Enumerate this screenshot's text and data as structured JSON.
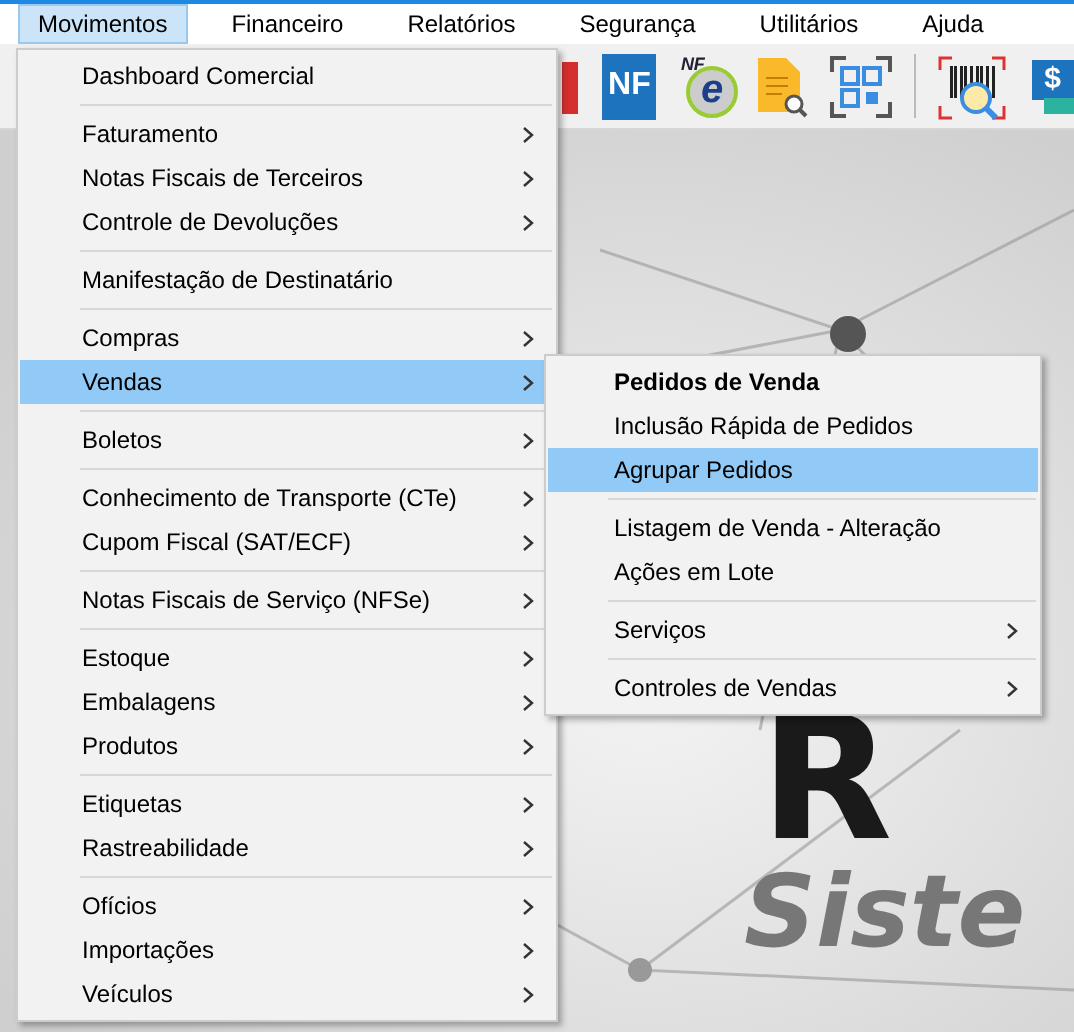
{
  "menubar": [
    {
      "label": "Movimentos",
      "selected": true
    },
    {
      "label": "Financeiro",
      "selected": false
    },
    {
      "label": "Relatórios",
      "selected": false
    },
    {
      "label": "Segurança",
      "selected": false
    },
    {
      "label": "Utilitários",
      "selected": false
    },
    {
      "label": "Ajuda",
      "selected": false
    }
  ],
  "toolbar": [
    {
      "kind": "red"
    },
    {
      "kind": "nf",
      "label": "NF"
    },
    {
      "kind": "nfe",
      "label": "NF",
      "mark": "e"
    },
    {
      "kind": "doc"
    },
    {
      "kind": "qr"
    },
    {
      "kind": "separator"
    },
    {
      "kind": "barcode"
    },
    {
      "kind": "money",
      "label": "$"
    }
  ],
  "logo": {
    "mark": "R",
    "tagline": "Siste"
  },
  "menu": [
    [
      {
        "label": "Dashboard Comercial",
        "submenu": false,
        "selected": false
      }
    ],
    [
      {
        "label": "Faturamento",
        "submenu": true,
        "selected": false
      },
      {
        "label": "Notas Fiscais de Terceiros",
        "submenu": true,
        "selected": false
      },
      {
        "label": "Controle de Devoluções",
        "submenu": true,
        "selected": false
      }
    ],
    [
      {
        "label": "Manifestação de Destinatário",
        "submenu": false,
        "selected": false
      }
    ],
    [
      {
        "label": "Compras",
        "submenu": true,
        "selected": false
      },
      {
        "label": "Vendas",
        "submenu": true,
        "selected": true
      }
    ],
    [
      {
        "label": "Boletos",
        "submenu": true,
        "selected": false
      }
    ],
    [
      {
        "label": "Conhecimento de Transporte (CTe)",
        "submenu": true,
        "selected": false
      },
      {
        "label": "Cupom Fiscal (SAT/ECF)",
        "submenu": true,
        "selected": false
      }
    ],
    [
      {
        "label": "Notas Fiscais de Serviço (NFSe)",
        "submenu": true,
        "selected": false
      }
    ],
    [
      {
        "label": "Estoque",
        "submenu": true,
        "selected": false
      },
      {
        "label": "Embalagens",
        "submenu": true,
        "selected": false
      },
      {
        "label": "Produtos",
        "submenu": true,
        "selected": false
      }
    ],
    [
      {
        "label": "Etiquetas",
        "submenu": true,
        "selected": false
      },
      {
        "label": "Rastreabilidade",
        "submenu": true,
        "selected": false
      }
    ],
    [
      {
        "label": "Ofícios",
        "submenu": true,
        "selected": false
      },
      {
        "label": "Importações",
        "submenu": true,
        "selected": false
      },
      {
        "label": "Veículos",
        "submenu": true,
        "selected": false
      }
    ]
  ],
  "submenu": [
    [
      {
        "label": "Pedidos de Venda",
        "submenu": false,
        "selected": false,
        "default": true
      },
      {
        "label": "Inclusão Rápida de Pedidos",
        "submenu": false,
        "selected": false,
        "default": false
      },
      {
        "label": "Agrupar Pedidos",
        "submenu": false,
        "selected": true,
        "default": false
      }
    ],
    [
      {
        "label": "Listagem de Venda - Alteração",
        "submenu": false,
        "selected": false,
        "default": false
      },
      {
        "label": "Ações em Lote",
        "submenu": false,
        "selected": false,
        "default": false
      }
    ],
    [
      {
        "label": "Serviços",
        "submenu": true,
        "selected": false,
        "default": false
      }
    ],
    [
      {
        "label": "Controles de Vendas",
        "submenu": true,
        "selected": false,
        "default": false
      }
    ]
  ]
}
